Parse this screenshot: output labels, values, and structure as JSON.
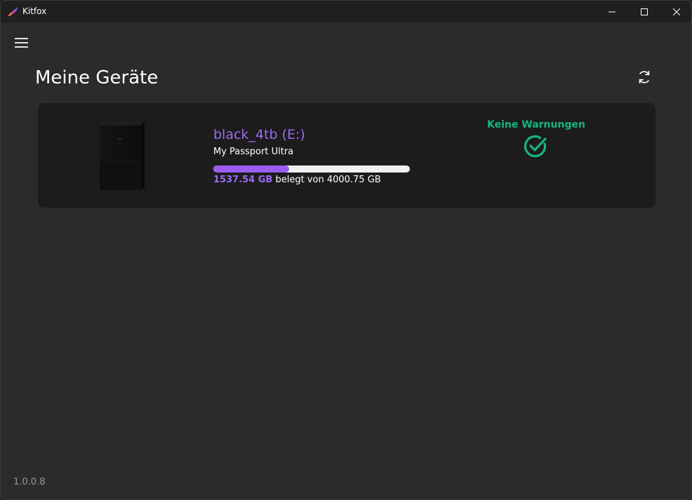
{
  "window": {
    "title": "Kitfox"
  },
  "header": {
    "title": "Meine Geräte"
  },
  "icons": {
    "menu": "hamburger-menu-icon",
    "refresh": "refresh-icon",
    "status": "check-circle-icon",
    "app": "kitfox-logo-icon"
  },
  "devices": [
    {
      "name": "black_4tb (E:)",
      "model": "My Passport Ultra",
      "used": "1537.54 GB",
      "usage_suffix": " belegt von 4000.75 GB",
      "usage_fraction": 0.3843,
      "status": "Keine Warnungen"
    }
  ],
  "footer": {
    "version": "1.0.0.8"
  },
  "colors": {
    "accent": "#9b6cf2",
    "ok": "#16b67f",
    "background": "#2b2b2b",
    "card": "#1c1c1c"
  }
}
